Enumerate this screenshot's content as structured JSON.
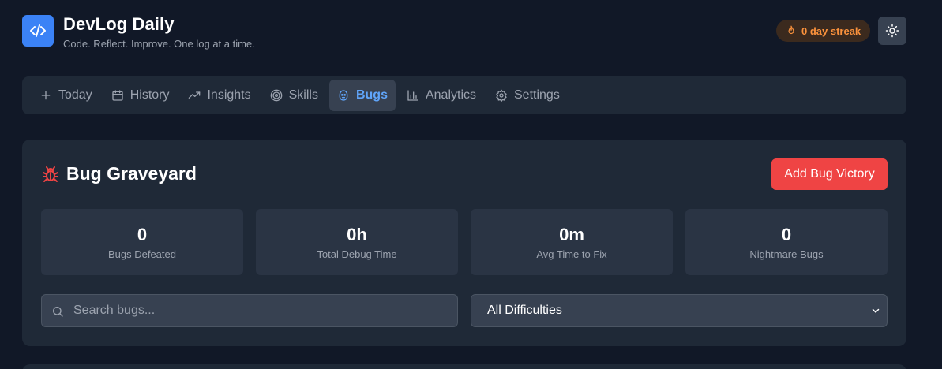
{
  "app": {
    "title": "DevLog Daily",
    "subtitle": "Code. Reflect. Improve. One log at a time.",
    "logo_icon": "code-icon",
    "accent_color": "#3b82f6"
  },
  "header": {
    "streak_label": "0 day streak",
    "streak_icon": "flame-icon",
    "theme_toggle_icon": "sun-icon"
  },
  "nav": {
    "items": [
      {
        "label": "Today",
        "icon": "plus-icon",
        "active": false
      },
      {
        "label": "History",
        "icon": "calendar-icon",
        "active": false
      },
      {
        "label": "Insights",
        "icon": "trending-up-icon",
        "active": false
      },
      {
        "label": "Skills",
        "icon": "target-icon",
        "active": false
      },
      {
        "label": "Bugs",
        "icon": "bug-icon",
        "active": true
      },
      {
        "label": "Analytics",
        "icon": "bar-chart-icon",
        "active": false
      },
      {
        "label": "Settings",
        "icon": "gear-icon",
        "active": false
      }
    ]
  },
  "bugs": {
    "title": "Bug Graveyard",
    "title_icon": "bug-icon",
    "add_button_label": "Add Bug Victory",
    "add_button_color": "#ef4444",
    "stats": [
      {
        "value": "0",
        "label": "Bugs Defeated"
      },
      {
        "value": "0h",
        "label": "Total Debug Time"
      },
      {
        "value": "0m",
        "label": "Avg Time to Fix"
      },
      {
        "value": "0",
        "label": "Nightmare Bugs"
      }
    ],
    "search_placeholder": "Search bugs...",
    "search_value": "",
    "difficulty_filter": "All Difficulties"
  }
}
